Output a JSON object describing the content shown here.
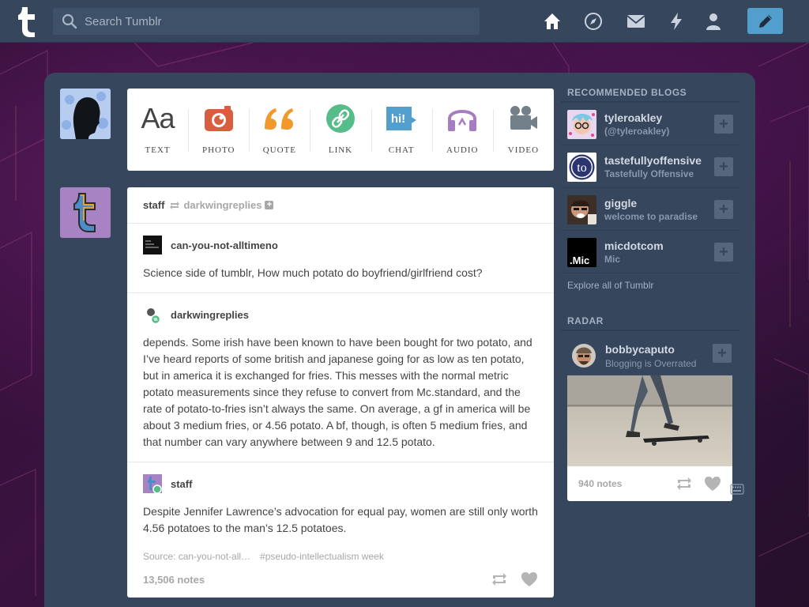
{
  "search": {
    "placeholder": "Search Tumblr"
  },
  "nav": {
    "icons": [
      "home-icon",
      "explore-icon",
      "inbox-icon",
      "activity-icon",
      "account-icon"
    ],
    "compose_icon": "pencil-icon"
  },
  "colors": {
    "topbar": "#36465d",
    "accent": "#529ecc",
    "panel": "#36465d"
  },
  "composer": {
    "types": [
      {
        "label": "TEXT",
        "icon": "text-icon",
        "glyph": "Aa",
        "color": "#444444"
      },
      {
        "label": "PHOTO",
        "icon": "camera-icon",
        "color": "#d95e40"
      },
      {
        "label": "QUOTE",
        "icon": "quote-icon",
        "glyph": "“",
        "color": "#f2992e"
      },
      {
        "label": "LINK",
        "icon": "link-icon",
        "color": "#56bc8a"
      },
      {
        "label": "CHAT",
        "icon": "chat-icon",
        "glyph": "hi!",
        "color": "#529ecc"
      },
      {
        "label": "AUDIO",
        "icon": "headphones-icon",
        "color": "#a77dc2"
      },
      {
        "label": "VIDEO",
        "icon": "video-camera-icon",
        "color": "#748089"
      }
    ]
  },
  "post": {
    "author": "staff",
    "reblogged_from": "darkwingreplies",
    "entries": [
      {
        "user": "can-you-not-alltimeno",
        "text": "Science side of tumblr, How much potato do boyfriend/girlfriend cost?"
      },
      {
        "user": "darkwingreplies",
        "text": "depends. Some irish have been known to have been bought for two potato, and I’ve heard reports of some british and japanese going for as low as ten potato, but in america it is exchanged for fries. This messes with the normal metric potato measurements since they refuse to convert from Mc.standard, and the rate of potato-to-fries isn’t always the same. On average, a gf in america will be about 3 medium fries, or 4.56 potato. A bf, though, is often 5 medium fries, and that number can vary anywhere between 9 and 12.5 potato."
      },
      {
        "user": "staff",
        "text": "Despite Jennifer Lawrence’s advocation for equal pay, women are still only worth 4.56 potatoes to the man’s 12.5 potatoes."
      }
    ],
    "source": "Source: can-you-not-all…",
    "tag": "#pseudo-intellectualism week",
    "notes": "13,506 notes"
  },
  "sidebar": {
    "recommended_title": "RECOMMENDED BLOGS",
    "blogs": [
      {
        "name": "tyleroakley",
        "sub": "(@tyleroakley)"
      },
      {
        "name": "tastefullyoffensive",
        "sub": "Tastefully Offensive"
      },
      {
        "name": "giggle",
        "sub": "welcome to paradise"
      },
      {
        "name": "micdotcom",
        "sub": "Mic"
      }
    ],
    "explore": "Explore all of Tumblr",
    "radar_title": "RADAR",
    "radar": {
      "name": "bobbycaputo",
      "sub": "Blogging is Overrated",
      "notes": "940 notes"
    },
    "logo_marks": {
      "to": "to",
      "mic": ".Mic"
    }
  }
}
